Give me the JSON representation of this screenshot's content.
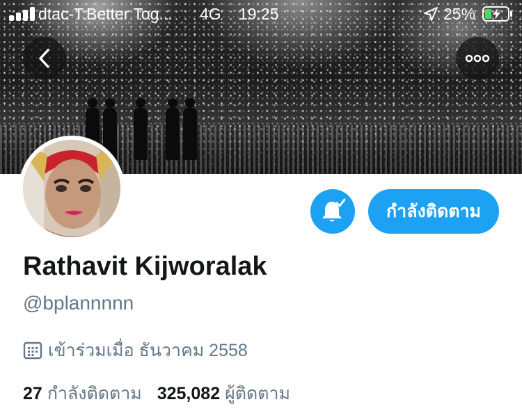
{
  "status_bar": {
    "carrier": "dtac-T:Better Tog...",
    "network": "4G",
    "time": "19:25",
    "battery": "25%"
  },
  "colors": {
    "accent": "#1da1f2",
    "secondary_text": "#657786",
    "primary_text": "#14171a",
    "battery_fill": "#4cd964"
  },
  "nav": {
    "back_icon": "chevron-left-icon",
    "more_icon": "more-horizontal-icon"
  },
  "actions": {
    "notify_icon": "bell-check-icon",
    "following_label": "กำลังติดตาม"
  },
  "profile": {
    "display_name": "Rathavit Kijworalak",
    "handle": "@bplannnnn",
    "joined_icon": "calendar-icon",
    "joined": "เข้าร่วมเมื่อ ธันวาคม 2558",
    "following_count": "27",
    "following_label": "กำลังติดตาม",
    "followers_count": "325,082",
    "followers_label": "ผู้ติดตาม"
  }
}
